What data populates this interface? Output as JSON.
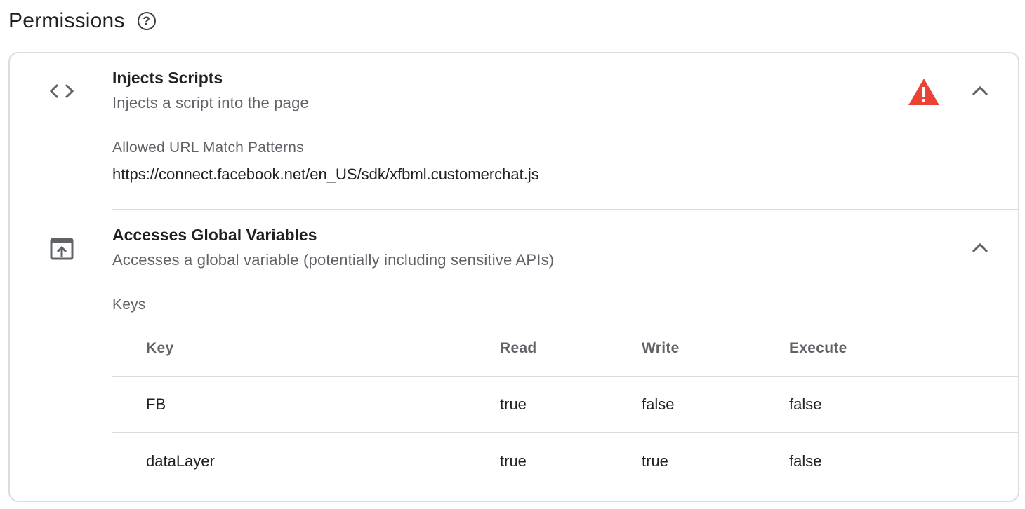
{
  "header": {
    "title": "Permissions",
    "help_icon": "help-circle-icon",
    "help_glyph": "?"
  },
  "permissions": [
    {
      "icon": "code-icon",
      "title": "Injects Scripts",
      "description": "Injects a script into the page",
      "has_warning": true,
      "warning_icon": "warning-icon",
      "expanded": true,
      "detail_label": "Allowed URL Match Patterns",
      "detail_value": "https://connect.facebook.net/en_US/sdk/xfbml.customerchat.js"
    },
    {
      "icon": "open-in-browser-icon",
      "title": "Accesses Global Variables",
      "description": "Accesses a global variable (potentially including sensitive APIs)",
      "has_warning": false,
      "expanded": true,
      "detail_label": "Keys",
      "table": {
        "columns": [
          "Key",
          "Read",
          "Write",
          "Execute"
        ],
        "rows": [
          [
            "FB",
            "true",
            "false",
            "false"
          ],
          [
            "dataLayer",
            "true",
            "true",
            "false"
          ]
        ]
      }
    }
  ],
  "colors": {
    "warning": "#ea4335",
    "icon": "#5f6368",
    "border": "#dadce0"
  }
}
